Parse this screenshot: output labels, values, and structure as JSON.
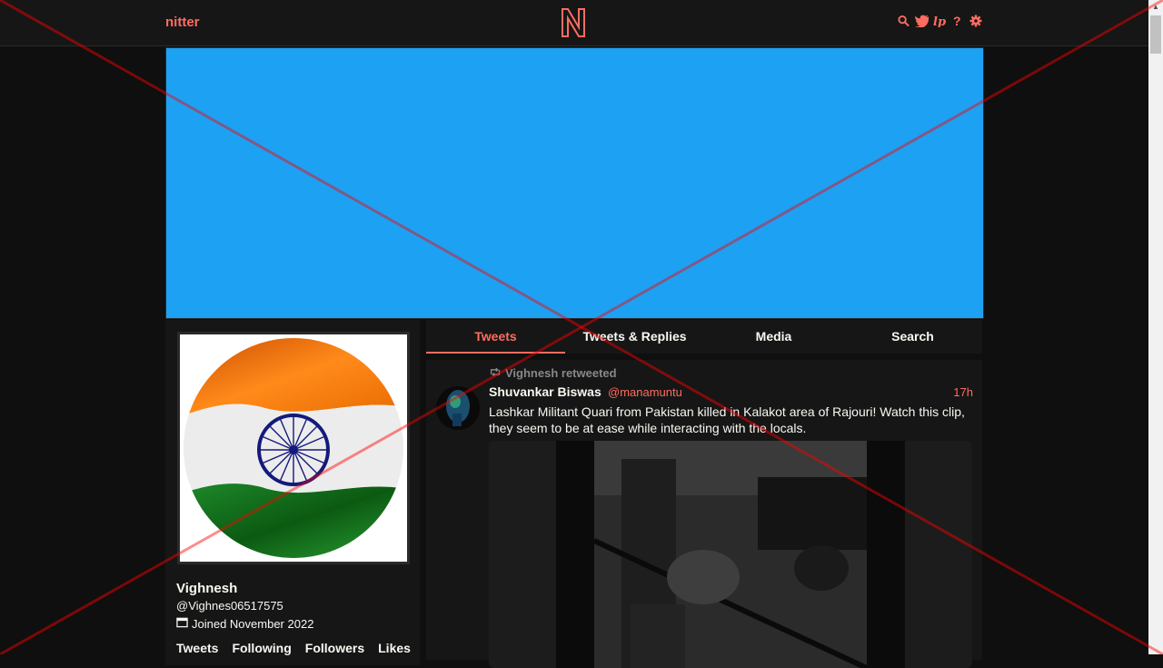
{
  "navbar": {
    "brand": "nitter",
    "icons": [
      "search-icon",
      "bird-icon",
      "rss-icon",
      "help-icon",
      "gear-icon"
    ]
  },
  "colors": {
    "accent": "#ff6c60",
    "banner": "#1da1f2",
    "background": "#0f0f0f",
    "panel": "#161616"
  },
  "profile": {
    "fullname": "Vighnesh",
    "username": "@Vighnes06517575",
    "joined": "Joined November 2022",
    "stats": [
      "Tweets",
      "Following",
      "Followers",
      "Likes"
    ]
  },
  "tabs": [
    {
      "label": "Tweets",
      "active": true
    },
    {
      "label": "Tweets & Replies",
      "active": false
    },
    {
      "label": "Media",
      "active": false
    },
    {
      "label": "Search",
      "active": false
    }
  ],
  "tweet": {
    "retweet_header": "Vighnesh retweeted",
    "fullname": "Shuvankar Biswas",
    "username": "@manamuntu",
    "date": "17h",
    "content": "Lashkar Militant Quari from Pakistan killed in Kalakot area of Rajouri! Watch this clip, they seem to be at ease while interacting with the locals."
  }
}
